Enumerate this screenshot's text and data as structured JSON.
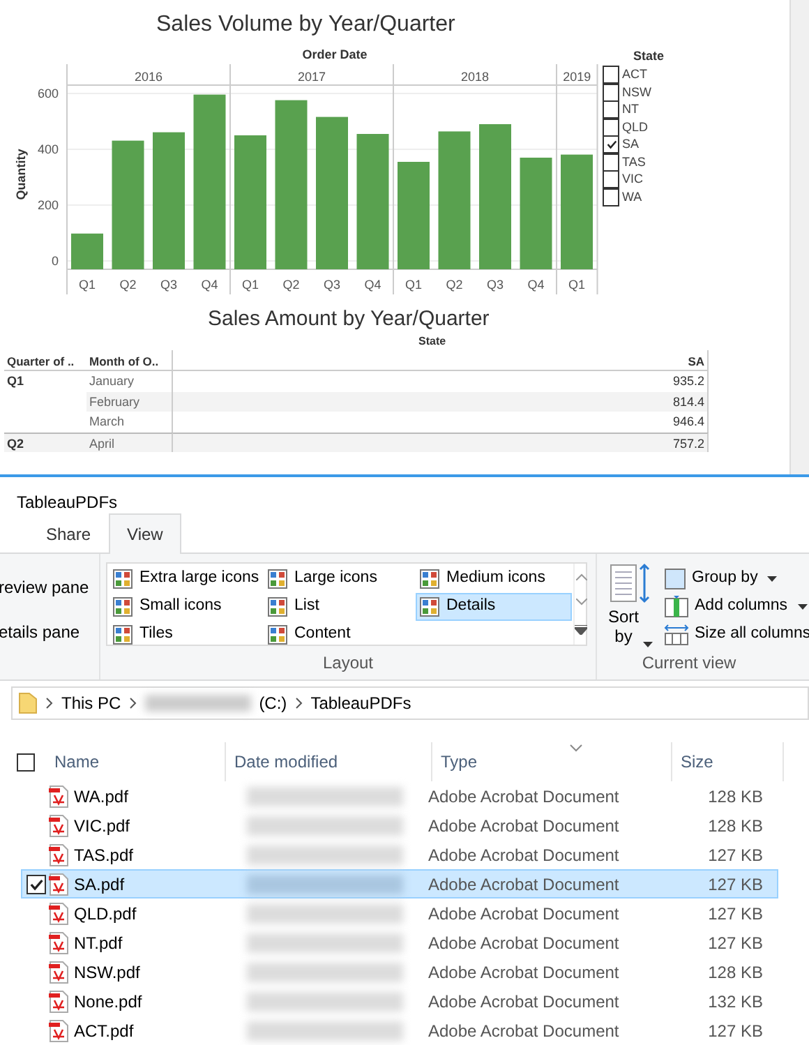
{
  "sales_volume": {
    "chart_data": {
      "type": "bar",
      "title": "Sales Volume by Year/Quarter",
      "xlabel": "Order Date",
      "categories": [
        "Q1",
        "Q2",
        "Q3",
        "Q4",
        "Q1",
        "Q2",
        "Q3",
        "Q4",
        "Q1",
        "Q2",
        "Q3",
        "Q4",
        "Q1"
      ],
      "annotations": [
        "2016",
        "2017",
        "2018",
        "2019"
      ],
      "series": [
        {
          "name": "Quantity",
          "color": "#59a14f",
          "values": [
            98,
            431,
            461,
            596,
            450,
            576,
            516,
            455,
            355,
            464,
            490,
            370,
            381
          ]
        }
      ],
      "ylim": [
        0,
        630
      ],
      "yticks": [
        0,
        200,
        400,
        600
      ],
      "grid": true
    }
  },
  "state_filter": {
    "title": "State",
    "items": [
      {
        "label": "ACT",
        "checked": false
      },
      {
        "label": "NSW",
        "checked": false
      },
      {
        "label": "NT",
        "checked": false
      },
      {
        "label": "QLD",
        "checked": false
      },
      {
        "label": "SA",
        "checked": true
      },
      {
        "label": "TAS",
        "checked": false
      },
      {
        "label": "VIC",
        "checked": false
      },
      {
        "label": "WA",
        "checked": false
      }
    ]
  },
  "sales_amount": {
    "title": "Sales Amount by Year/Quarter",
    "column_group": "State",
    "columns": [
      "Quarter of ..",
      "Month of O..",
      "SA"
    ],
    "rows": [
      {
        "quarter": "Q1",
        "month": "January",
        "value": "935.2"
      },
      {
        "month": "February",
        "value": "814.4"
      },
      {
        "month": "March",
        "value": "946.4"
      },
      {
        "quarter": "Q2",
        "month": "April",
        "value": "757.2"
      }
    ]
  },
  "explorer": {
    "title": "TableauPDFs",
    "tabs": [
      {
        "label": "Share",
        "selected": false
      },
      {
        "label": "View",
        "selected": true
      }
    ],
    "panes": [
      "review pane",
      "etails pane"
    ],
    "layout": {
      "label": "Layout",
      "items": [
        {
          "label": "Extra large icons",
          "selected": false
        },
        {
          "label": "Large icons",
          "selected": false
        },
        {
          "label": "Medium icons",
          "selected": false
        },
        {
          "label": "Small icons",
          "selected": false
        },
        {
          "label": "List",
          "selected": false
        },
        {
          "label": "Details",
          "selected": true
        },
        {
          "label": "Tiles",
          "selected": false
        },
        {
          "label": "Content",
          "selected": false
        }
      ]
    },
    "current_view": {
      "label": "Current view",
      "sort": [
        "Sort",
        "by"
      ],
      "commands": [
        {
          "label": "Group by",
          "dropdown": true
        },
        {
          "label": "Add columns",
          "dropdown": true
        },
        {
          "label": "Size all columns",
          "dropdown": false
        }
      ]
    },
    "address": [
      "This PC",
      "(C:)",
      "TableauPDFs"
    ],
    "select_all": {
      "checked": false
    },
    "columns": [
      "Name",
      "Date modified",
      "Type",
      "Size"
    ],
    "files": [
      {
        "name": "WA.pdf",
        "type": "Adobe Acrobat Document",
        "size": "128 KB",
        "selected": false
      },
      {
        "name": "VIC.pdf",
        "type": "Adobe Acrobat Document",
        "size": "128 KB",
        "selected": false
      },
      {
        "name": "TAS.pdf",
        "type": "Adobe Acrobat Document",
        "size": "127 KB",
        "selected": false
      },
      {
        "name": "SA.pdf",
        "type": "Adobe Acrobat Document",
        "size": "127 KB",
        "selected": true
      },
      {
        "name": "QLD.pdf",
        "type": "Adobe Acrobat Document",
        "size": "127 KB",
        "selected": false
      },
      {
        "name": "NT.pdf",
        "type": "Adobe Acrobat Document",
        "size": "127 KB",
        "selected": false
      },
      {
        "name": "NSW.pdf",
        "type": "Adobe Acrobat Document",
        "size": "128 KB",
        "selected": false
      },
      {
        "name": "None.pdf",
        "type": "Adobe Acrobat Document",
        "size": "132 KB",
        "selected": false
      },
      {
        "name": "ACT.pdf",
        "type": "Adobe Acrobat Document",
        "size": "127 KB",
        "selected": false
      }
    ]
  }
}
